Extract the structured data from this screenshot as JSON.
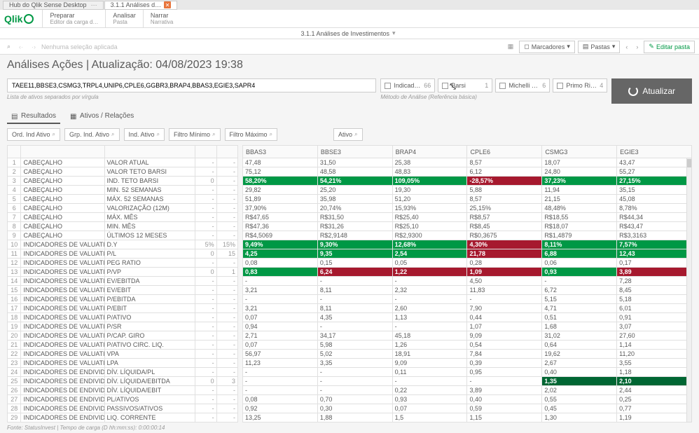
{
  "tabs": {
    "hub": "Hub do Qlik Sense Desktop",
    "doc": "3.1.1 Análises d…"
  },
  "logo": "Qlik",
  "headerSections": [
    {
      "title": "Preparar",
      "sub": "Editor da carga d…"
    },
    {
      "title": "Analisar",
      "sub": "Pasta"
    },
    {
      "title": "Narrar",
      "sub": "Narrativa"
    }
  ],
  "breadcrumb": {
    "title": "3.1.1 Análises de Investimentos"
  },
  "toolbar": {
    "noSelection": "Nenhuma seleção aplicada",
    "bookmarks": "Marcadores",
    "sheets": "Pastas",
    "edit": "Editar pasta"
  },
  "pageTitle": "Análises Ações | Atualização: 04/08/2023 19:38",
  "filter": {
    "value": "TAEE11,BBSE3,CSMG3,TRPL4,UNIP6,CPLE6,GGBR3,BRAP4,BBAS3,EGIE3,SAPR4",
    "hint": "Lista de ativos separados por vírgula",
    "checks": [
      {
        "label": "Indicado…",
        "n": "66"
      },
      {
        "label": "Barsi",
        "n": "1"
      },
      {
        "label": "Michelli D…",
        "n": "6"
      },
      {
        "label": "Primo Rico",
        "n": "4"
      }
    ],
    "method": "Método de Análise (Referência básica)",
    "updateBtn": "Atualizar"
  },
  "viewTabs": {
    "results": "Resultados",
    "assets": "Ativos / Relações"
  },
  "pills": {
    "ord": "Ord. Ind Ativo",
    "grp": "Grp. Ind. Ativo",
    "ind": "Ind. Ativo",
    "min": "Filtro Mínimo",
    "max": "Filtro Máximo",
    "ativo": "Ativo"
  },
  "headers": [
    "BBAS3",
    "BBSE3",
    "BRAP4",
    "CPLE6",
    "CSMG3",
    "EGIE3"
  ],
  "rows": [
    {
      "n": "1",
      "cat": "CABEÇALHO",
      "ind": "VALOR ATUAL",
      "c1": "",
      "c2": "",
      "d": [
        "47,48",
        "31,50",
        "25,38",
        "8,57",
        "18,07",
        "43,47"
      ]
    },
    {
      "n": "2",
      "cat": "CABEÇALHO",
      "ind": "VALOR TETO BARSI",
      "c1": "",
      "c2": "",
      "d": [
        "75,12",
        "48,58",
        "48,83",
        "6,12",
        "24,80",
        "55,27"
      ]
    },
    {
      "n": "3",
      "cat": "CABEÇALHO",
      "ind": "IND. TETO BARSI",
      "c1": "0",
      "c2": "",
      "d": [
        "58,20%",
        "54,21%",
        "109,05%",
        "-28,57%",
        "37,23%",
        "27,15%"
      ],
      "cls": [
        "g",
        "g",
        "g",
        "r",
        "g",
        "g"
      ]
    },
    {
      "n": "4",
      "cat": "CABEÇALHO",
      "ind": "MIN. 52 SEMANAS",
      "c1": "",
      "c2": "",
      "d": [
        "29,82",
        "25,20",
        "19,30",
        "5,88",
        "11,94",
        "35,15"
      ]
    },
    {
      "n": "5",
      "cat": "CABEÇALHO",
      "ind": "MÁX. 52 SEMANAS",
      "c1": "",
      "c2": "",
      "d": [
        "51,89",
        "35,98",
        "51,20",
        "8,57",
        "21,15",
        "45,08"
      ]
    },
    {
      "n": "6",
      "cat": "CABEÇALHO",
      "ind": "VALORIZAÇÃO (12M)",
      "c1": "",
      "c2": "",
      "d": [
        "37,90%",
        "20,74%",
        "15,93%",
        "25,15%",
        "48,48%",
        "8,78%"
      ]
    },
    {
      "n": "7",
      "cat": "CABEÇALHO",
      "ind": "MÁX. MÊS",
      "c1": "",
      "c2": "",
      "d": [
        "R$47,65",
        "R$31,50",
        "R$25,40",
        "R$8,57",
        "R$18,55",
        "R$44,34"
      ]
    },
    {
      "n": "8",
      "cat": "CABEÇALHO",
      "ind": "MIN. MÊS",
      "c1": "",
      "c2": "",
      "d": [
        "R$47,36",
        "R$31,26",
        "R$25,10",
        "R$8,45",
        "R$18,07",
        "R$43,47"
      ]
    },
    {
      "n": "9",
      "cat": "CABEÇALHO",
      "ind": "ÚLTIMOS 12 MESES",
      "c1": "",
      "c2": "",
      "d": [
        "R$4,5069",
        "R$2,9148",
        "R$2,9300",
        "R$0,3675",
        "R$1,4879",
        "R$3,3163"
      ]
    },
    {
      "n": "10",
      "cat": "INDICADORES DE VALUATION",
      "ind": "D.Y",
      "c1": "5%",
      "c2": "15%",
      "d": [
        "9,49%",
        "9,30%",
        "12,68%",
        "4,30%",
        "8,11%",
        "7,57%"
      ],
      "cls": [
        "g",
        "g",
        "g",
        "r",
        "g",
        "g"
      ]
    },
    {
      "n": "11",
      "cat": "INDICADORES DE VALUATION",
      "ind": "P/L",
      "c1": "0",
      "c2": "15",
      "d": [
        "4,25",
        "9,35",
        "2,54",
        "21,78",
        "6,88",
        "12,43"
      ],
      "cls": [
        "g",
        "g",
        "g",
        "r",
        "g",
        "g"
      ]
    },
    {
      "n": "12",
      "cat": "INDICADORES DE VALUATION",
      "ind": "PEG RATIO",
      "c1": "",
      "c2": "",
      "d": [
        "0,08",
        "0,15",
        "0,05",
        "0,28",
        "0,06",
        "0,17"
      ]
    },
    {
      "n": "13",
      "cat": "INDICADORES DE VALUATION",
      "ind": "P/VP",
      "c1": "0",
      "c2": "1",
      "d": [
        "0,83",
        "6,24",
        "1,22",
        "1,09",
        "0,93",
        "3,89"
      ],
      "cls": [
        "g",
        "r",
        "r",
        "r",
        "g",
        "r"
      ]
    },
    {
      "n": "14",
      "cat": "INDICADORES DE VALUATION",
      "ind": "EV/EBITDA",
      "c1": "",
      "c2": "",
      "d": [
        "-",
        "-",
        "-",
        "4,50",
        "-",
        "7,28"
      ]
    },
    {
      "n": "15",
      "cat": "INDICADORES DE VALUATION",
      "ind": "EV/EBIT",
      "c1": "",
      "c2": "",
      "d": [
        "3,21",
        "8,11",
        "2,32",
        "11,83",
        "6,72",
        "8,45"
      ]
    },
    {
      "n": "16",
      "cat": "INDICADORES DE VALUATION",
      "ind": "P/EBITDA",
      "c1": "",
      "c2": "",
      "d": [
        "-",
        "-",
        "-",
        "-",
        "5,15",
        "5,18"
      ]
    },
    {
      "n": "17",
      "cat": "INDICADORES DE VALUATION",
      "ind": "P/EBIT",
      "c1": "",
      "c2": "",
      "d": [
        "3,21",
        "8,11",
        "2,60",
        "7,90",
        "4,71",
        "6,01"
      ]
    },
    {
      "n": "18",
      "cat": "INDICADORES DE VALUATION",
      "ind": "P/ATIVO",
      "c1": "",
      "c2": "",
      "d": [
        "0,07",
        "4,35",
        "1,13",
        "0,44",
        "0,51",
        "0,91"
      ]
    },
    {
      "n": "19",
      "cat": "INDICADORES DE VALUATION",
      "ind": "P/SR",
      "c1": "",
      "c2": "",
      "d": [
        "0,94",
        "-",
        "-",
        "1,07",
        "1,68",
        "3,07"
      ]
    },
    {
      "n": "20",
      "cat": "INDICADORES DE VALUATION",
      "ind": "P/CAP. GIRO",
      "c1": "",
      "c2": "",
      "d": [
        "2,71",
        "34,17",
        "45,18",
        "9,09",
        "31,02",
        "27,60"
      ]
    },
    {
      "n": "21",
      "cat": "INDICADORES DE VALUATION",
      "ind": "P/ATIVO CIRC. LIQ.",
      "c1": "",
      "c2": "",
      "d": [
        "0,07",
        "5,98",
        "1,26",
        "0,54",
        "0,64",
        "1,14"
      ]
    },
    {
      "n": "22",
      "cat": "INDICADORES DE VALUATION",
      "ind": "VPA",
      "c1": "",
      "c2": "",
      "d": [
        "56,97",
        "5,02",
        "18,91",
        "7,84",
        "19,62",
        "11,20"
      ]
    },
    {
      "n": "23",
      "cat": "INDICADORES DE VALUATION",
      "ind": "LPA",
      "c1": "",
      "c2": "",
      "d": [
        "11,23",
        "3,35",
        "9,09",
        "0,39",
        "2,67",
        "3,55"
      ]
    },
    {
      "n": "24",
      "cat": "INDICADORES DE ENDIVIDAMENTO",
      "ind": "DÍV. LÍQUIDA/PL",
      "c1": "",
      "c2": "",
      "d": [
        "-",
        "-",
        "0,11",
        "0,95",
        "0,40",
        "1,18"
      ]
    },
    {
      "n": "25",
      "cat": "INDICADORES DE ENDIVIDAMENTO",
      "ind": "DÍV. LÍQUIDA/EBITDA",
      "c1": "0",
      "c2": "3",
      "d": [
        "-",
        "-",
        "-",
        "-",
        "1,35",
        "2,10"
      ],
      "cls": [
        "",
        "",
        "",
        "",
        "dg",
        "dg"
      ]
    },
    {
      "n": "26",
      "cat": "INDICADORES DE ENDIVIDAMENTO",
      "ind": "DÍV. LÍQUIDA/EBIT",
      "c1": "",
      "c2": "",
      "d": [
        "-",
        "-",
        "0,22",
        "3,89",
        "2,02",
        "2,44"
      ]
    },
    {
      "n": "27",
      "cat": "INDICADORES DE ENDIVIDAMENTO",
      "ind": "PL/ATIVOS",
      "c1": "",
      "c2": "",
      "d": [
        "0,08",
        "0,70",
        "0,93",
        "0,40",
        "0,55",
        "0,25"
      ]
    },
    {
      "n": "28",
      "cat": "INDICADORES DE ENDIVIDAMENTO",
      "ind": "PASSIVOS/ATIVOS",
      "c1": "",
      "c2": "",
      "d": [
        "0,92",
        "0,30",
        "0,07",
        "0,59",
        "0,45",
        "0,77"
      ]
    },
    {
      "n": "29",
      "cat": "INDICADORES DE ENDIVIDAMENTO",
      "ind": "LIQ. CORRENTE",
      "c1": "",
      "c2": "",
      "d": [
        "13,25",
        "1,88",
        "1,5",
        "1,15",
        "1,30",
        "1,19"
      ]
    }
  ],
  "footer": "Fonte: StatusInvest | Tempo de carga (D hh:mm:ss): 0:00:00:14"
}
